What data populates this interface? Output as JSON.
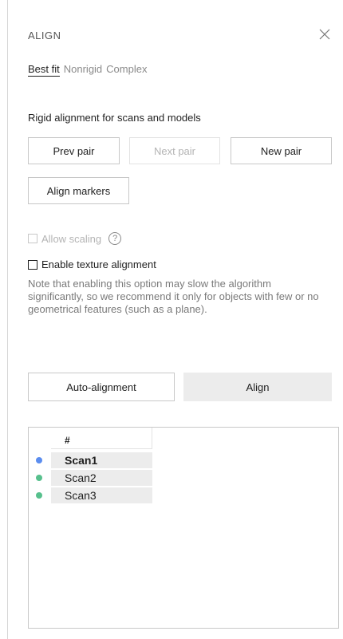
{
  "panel": {
    "title": "ALIGN",
    "close_icon": "close-icon"
  },
  "tabs": [
    {
      "label": "Best fit",
      "active": true
    },
    {
      "label": "Nonrigid",
      "active": false
    },
    {
      "label": "Complex",
      "active": false
    }
  ],
  "rigid": {
    "section_label": "Rigid alignment for scans and models",
    "prev_pair_label": "Prev pair",
    "next_pair_label": "Next pair",
    "new_pair_label": "New pair",
    "align_markers_label": "Align markers"
  },
  "options": {
    "allow_scaling_label": "Allow scaling",
    "allow_scaling_checked": false,
    "allow_scaling_disabled": true,
    "help_icon": "help-icon",
    "help_glyph": "?",
    "texture_alignment_label": "Enable texture alignment",
    "texture_alignment_checked": false,
    "note": "Note that enabling this option may slow the algorithm significantly, so we recommend it only for objects with few or no geometrical features (such as a plane)."
  },
  "actions": {
    "auto_alignment_label": "Auto-alignment",
    "align_label": "Align"
  },
  "scan_list": {
    "header": "#",
    "items": [
      {
        "name": "Scan1",
        "color": "#5b8def",
        "selected": true
      },
      {
        "name": "Scan2",
        "color": "#57c08d",
        "selected": false
      },
      {
        "name": "Scan3",
        "color": "#57c08d",
        "selected": false
      }
    ]
  }
}
